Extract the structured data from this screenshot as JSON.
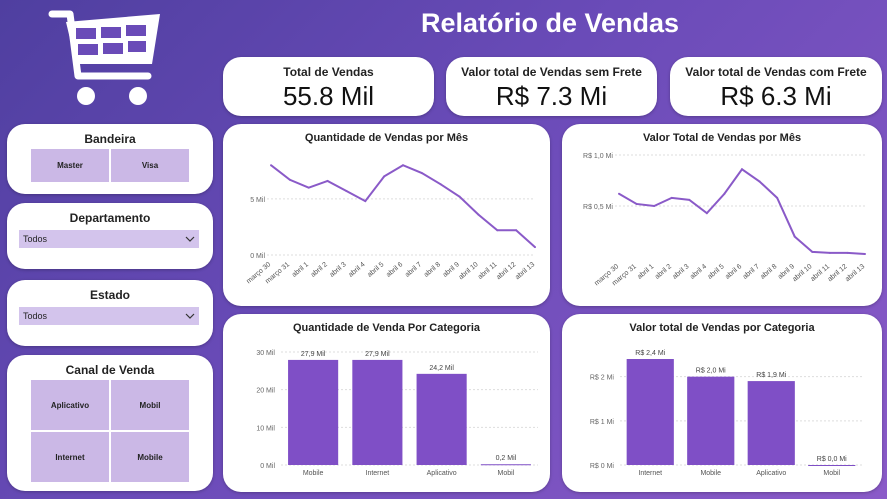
{
  "header": {
    "title": "Relatório de Vendas"
  },
  "logo": {
    "icon": "shopping-cart-icon",
    "color": "#ffffff"
  },
  "kpis": [
    {
      "label": "Total de Vendas",
      "value": "55.8 Mil"
    },
    {
      "label": "Valor total de Vendas sem Frete",
      "value": "R$ 7.3 Mi"
    },
    {
      "label": "Valor total de Vendas com Frete",
      "value": "R$ 6.3 Mi"
    }
  ],
  "slicers": {
    "bandeira": {
      "title": "Bandeira",
      "options": [
        "Master",
        "Visa"
      ]
    },
    "departamento": {
      "title": "Departamento",
      "selected": "Todos"
    },
    "estado": {
      "title": "Estado",
      "selected": "Todos"
    },
    "canal": {
      "title": "Canal de Venda",
      "options": [
        "Aplicativo",
        "Mobil",
        "Internet",
        "Mobile"
      ]
    }
  },
  "colors": {
    "accent": "#7f4fc6",
    "tile": "#cbb8e6",
    "line": "#8a5ac8"
  },
  "chart_data": [
    {
      "type": "line",
      "title": "Quantidade de Vendas por Mês",
      "x": [
        "março 30",
        "março 31",
        "abril 1",
        "abril 2",
        "abril 3",
        "abril 4",
        "abril 5",
        "abril 6",
        "abril 7",
        "abril 8",
        "abril 9",
        "abril 10",
        "abril 11",
        "abril 12",
        "abril 13"
      ],
      "values": [
        8000,
        6700,
        6000,
        6600,
        5700,
        4800,
        7000,
        8000,
        7300,
        6300,
        5200,
        3600,
        2200,
        2200,
        700
      ],
      "ylim": [
        0,
        9000
      ],
      "yticks": [
        "0 Mil",
        "5 Mil"
      ],
      "ytick_values": [
        0,
        5000
      ]
    },
    {
      "type": "line",
      "title": "Valor Total de Vendas por Mês",
      "x": [
        "março 30",
        "março 31",
        "abril 1",
        "abril 2",
        "abril 3",
        "abril 4",
        "abril 5",
        "abril 6",
        "abril 7",
        "abril 8",
        "abril 9",
        "abril 10",
        "abril 11",
        "abril 12",
        "abril 13"
      ],
      "values": [
        0.62,
        0.52,
        0.5,
        0.58,
        0.56,
        0.43,
        0.62,
        0.86,
        0.74,
        0.58,
        0.2,
        0.05,
        0.04,
        0.04,
        0.03
      ],
      "ylim": [
        0,
        1.0
      ],
      "yticks": [
        "R$ 0,5 Mi",
        "R$ 1,0 Mi"
      ],
      "ytick_values": [
        0.5,
        1.0
      ]
    },
    {
      "type": "bar",
      "title": "Quantidade de Venda Por Categoria",
      "categories": [
        "Mobile",
        "Internet",
        "Aplicativo",
        "Mobil"
      ],
      "values": [
        27.9,
        27.9,
        24.2,
        0.2
      ],
      "labels": [
        "27,9 Mil",
        "27,9 Mil",
        "24,2 Mil",
        "0,2 Mil"
      ],
      "ylim": [
        0,
        30
      ],
      "yticks": [
        "0 Mil",
        "10 Mil",
        "20 Mil",
        "30 Mil"
      ],
      "ytick_values": [
        0,
        10,
        20,
        30
      ]
    },
    {
      "type": "bar",
      "title": "Valor total de Vendas por Categoria",
      "categories": [
        "Internet",
        "Mobile",
        "Aplicativo",
        "Mobil"
      ],
      "values": [
        2.4,
        2.0,
        1.9,
        0.0
      ],
      "labels": [
        "R$ 2,4 Mi",
        "R$ 2,0 Mi",
        "R$ 1,9 Mi",
        "R$ 0,0 Mi"
      ],
      "ylim": [
        0,
        2.4
      ],
      "yticks": [
        "R$ 0 Mi",
        "R$ 1 Mi",
        "R$ 2 Mi"
      ],
      "ytick_values": [
        0,
        1,
        2
      ]
    }
  ]
}
